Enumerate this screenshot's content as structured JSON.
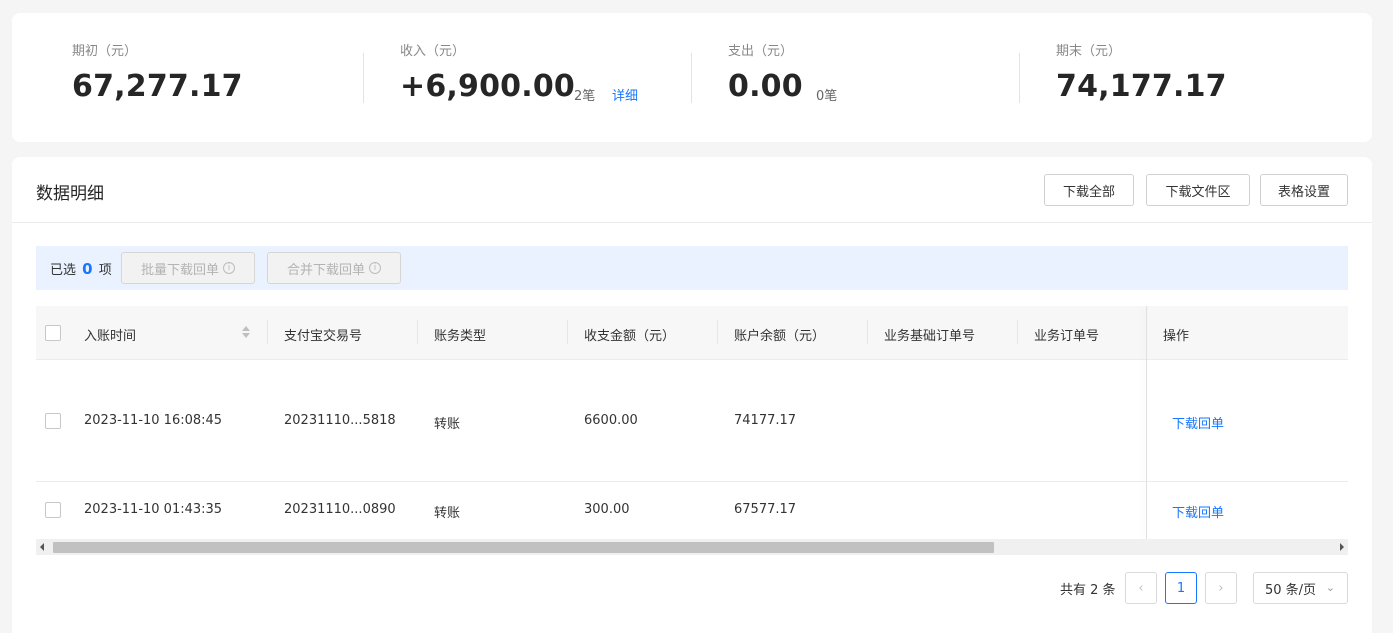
{
  "summary": {
    "opening": {
      "label": "期初（元）",
      "value": "67,277.17"
    },
    "income": {
      "label": "收入（元）",
      "value": "+6,900.00",
      "count": "2笔",
      "link": "详细"
    },
    "expense": {
      "label": "支出（元）",
      "value": "0.00",
      "count": "0笔"
    },
    "closing": {
      "label": "期末（元）",
      "value": "74,177.17"
    }
  },
  "section": {
    "title": "数据明细",
    "buttons": {
      "download_all": "下载全部",
      "download_files": "下载文件区",
      "table_settings": "表格设置"
    }
  },
  "selection": {
    "prefix": "已选",
    "count": "0",
    "suffix": "项",
    "batch_download": "批量下载回单",
    "merge_download": "合并下载回单"
  },
  "table": {
    "columns": [
      "入账时间",
      "支付宝交易号",
      "账务类型",
      "收支金额（元）",
      "账户余额（元）",
      "业务基础订单号",
      "业务订单号",
      "操作"
    ],
    "rows": [
      {
        "time": "2023-11-10 16:08:45",
        "trade_no": "20231110...5818",
        "type": "转账",
        "amount": "6600.00",
        "balance": "74177.17",
        "base_order": "",
        "order": "",
        "action": "下载回单"
      },
      {
        "time": "2023-11-10 01:43:35",
        "trade_no": "20231110...0890",
        "type": "转账",
        "amount": "300.00",
        "balance": "67577.17",
        "base_order": "",
        "order": "",
        "action": "下载回单"
      }
    ]
  },
  "pagination": {
    "total": "共有 2 条",
    "prev_icon": "‹",
    "current": "1",
    "next_icon": "›",
    "page_size": "50 条/页"
  }
}
